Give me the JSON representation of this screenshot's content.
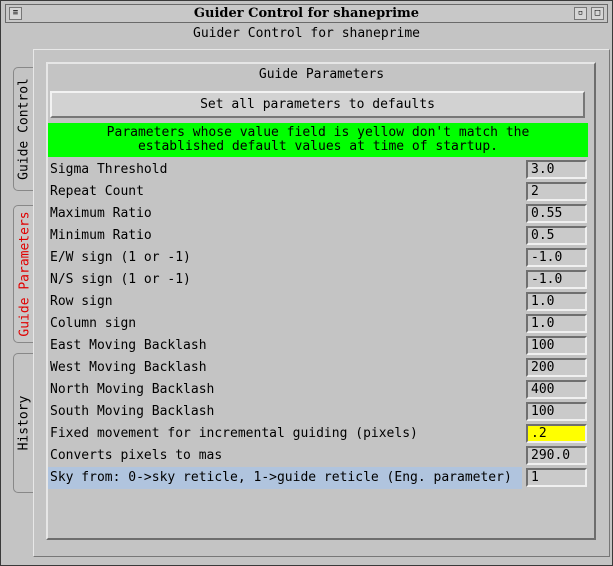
{
  "window": {
    "titlebar": "Guider Control for shaneprime",
    "heading": "Guider Control for shaneprime",
    "menu_glyph": "≡",
    "min_glyph": "▫",
    "max_glyph": "□"
  },
  "tabs": [
    {
      "label": "Guide Control",
      "active": false
    },
    {
      "label": "Guide Parameters",
      "active": true
    },
    {
      "label": "History",
      "active": false
    }
  ],
  "panel": {
    "group_title": "Guide Parameters",
    "defaults_button": "Set all parameters to defaults",
    "note_line1": "Parameters whose value field is yellow don't match the",
    "note_line2": "established default values at time of startup.",
    "note_color": "#00ff00",
    "mismatch_color": "#ffff00",
    "rows": [
      {
        "label": "Sigma Threshold",
        "value": "3.0"
      },
      {
        "label": "Repeat Count",
        "value": "2"
      },
      {
        "label": "Maximum Ratio",
        "value": "0.55"
      },
      {
        "label": "Minimum Ratio",
        "value": "0.5"
      },
      {
        "label": "E/W sign (1 or -1)",
        "value": "-1.0"
      },
      {
        "label": "N/S sign (1 or -1)",
        "value": "-1.0"
      },
      {
        "label": "Row sign",
        "value": "1.0"
      },
      {
        "label": "Column sign",
        "value": "1.0"
      },
      {
        "label": "East Moving Backlash",
        "value": "100"
      },
      {
        "label": "West Moving Backlash",
        "value": "200"
      },
      {
        "label": "North Moving Backlash",
        "value": "400"
      },
      {
        "label": "South Moving Backlash",
        "value": "100"
      },
      {
        "label": "Fixed movement for incremental guiding (pixels)",
        "value": ".2"
      },
      {
        "label": "Converts pixels to mas",
        "value": "290.0"
      },
      {
        "label": "Sky from: 0->sky reticle, 1->guide reticle (Eng. parameter)",
        "value": "1"
      }
    ]
  }
}
